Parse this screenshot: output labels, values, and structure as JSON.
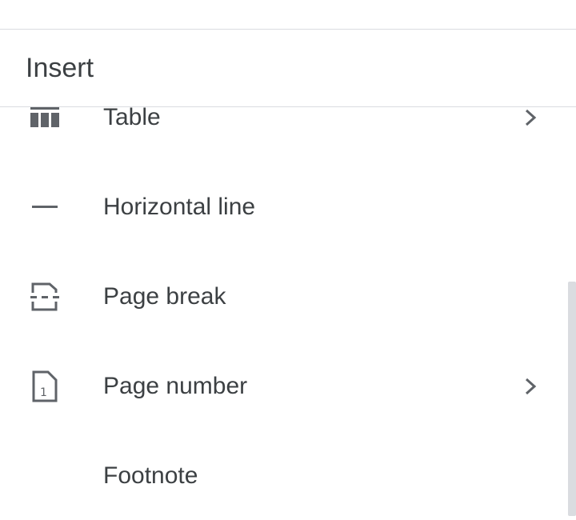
{
  "header": {
    "title": "Insert"
  },
  "menu": {
    "items": [
      {
        "label": "Table",
        "icon": "table-icon",
        "has_submenu": true
      },
      {
        "label": "Horizontal line",
        "icon": "horizontal-line-icon",
        "has_submenu": false
      },
      {
        "label": "Page break",
        "icon": "page-break-icon",
        "has_submenu": false
      },
      {
        "label": "Page number",
        "icon": "page-number-icon",
        "has_submenu": true
      },
      {
        "label": "Footnote",
        "icon": "",
        "has_submenu": false
      }
    ]
  },
  "icons": {
    "page_number_glyph": "1"
  },
  "colors": {
    "text": "#3c4043",
    "icon": "#5f6368",
    "divider": "#dadce0",
    "scrollbar": "#dadce0",
    "background": "#ffffff"
  }
}
